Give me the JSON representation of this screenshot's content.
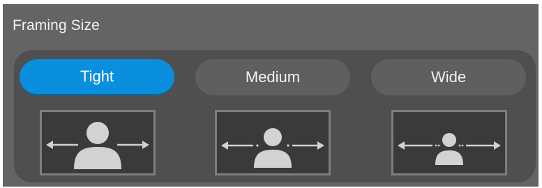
{
  "panel": {
    "title": "Framing Size"
  },
  "options": [
    {
      "label": "Tight",
      "selected": true,
      "icon": "person-tight-framing-icon"
    },
    {
      "label": "Medium",
      "selected": false,
      "icon": "person-medium-framing-icon"
    },
    {
      "label": "Wide",
      "selected": false,
      "icon": "person-wide-framing-icon"
    }
  ],
  "colors": {
    "panel_bg": "#646464",
    "group_bg": "#4f4f4f",
    "button_bg": "#5f5f5f",
    "accent": "#0a8ede",
    "preview_bg": "#3a3a3a",
    "preview_border": "#7e7e7e",
    "icon": "#d2d2d2"
  }
}
